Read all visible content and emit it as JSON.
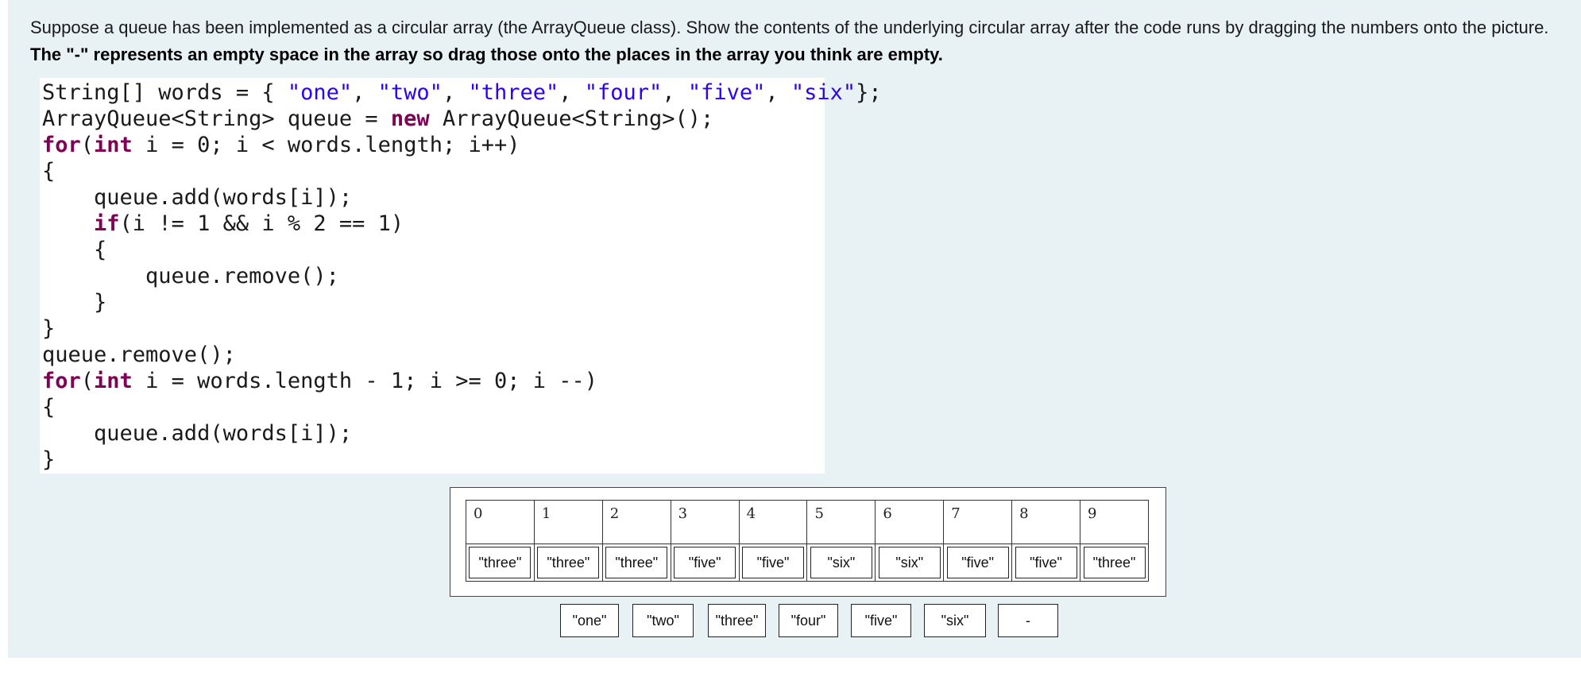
{
  "prompt": {
    "text": "Suppose a queue has been implemented as a circular array (the ArrayQueue class). Show the contents of the underlying circular array after the code runs by dragging the numbers onto the picture. ",
    "bold_text": "The \"-\" represents an empty space in the array so drag those onto the places in the array you think are empty."
  },
  "code": {
    "l1": {
      "a": "String[] words = { ",
      "s1": "\"one\"",
      "c1": ", ",
      "s2": "\"two\"",
      "c2": ", ",
      "s3": "\"three\"",
      "c3": ", ",
      "s4": "\"four\"",
      "c4": ", ",
      "s5": "\"five\"",
      "c5": ", ",
      "s6": "\"six\"",
      "z": "};"
    },
    "l2": {
      "a": "ArrayQueue<String> queue = ",
      "kw": "new",
      "b": " ArrayQueue<String>();"
    },
    "l3": {
      "kw1": "for",
      "a": "(",
      "kw2": "int",
      "b": " i = 0; i < words.length; i++)"
    },
    "l4": "{",
    "l5": "    queue.add(words[i]);",
    "l6": {
      "ind": "    ",
      "kw": "if",
      "b": "(i != 1 && i % 2 == 1)"
    },
    "l7": "    {",
    "l8": "        queue.remove();",
    "l9": "    }",
    "l10": "}",
    "l11": "queue.remove();",
    "l12": {
      "kw1": "for",
      "a": "(",
      "kw2": "int",
      "b": " i = words.length - 1; i >= 0; i --)"
    },
    "l13": "{",
    "l14": "    queue.add(words[i]);",
    "l15": "}"
  },
  "array": {
    "indices": [
      "0",
      "1",
      "2",
      "3",
      "4",
      "5",
      "6",
      "7",
      "8",
      "9"
    ],
    "values": [
      "\"three\"",
      "\"three\"",
      "\"three\"",
      "\"five\"",
      "\"five\"",
      "\"six\"",
      "\"six\"",
      "\"five\"",
      "\"five\"",
      "\"three\""
    ]
  },
  "bank": [
    "\"one\"",
    "\"two\"",
    "\"three\"",
    "\"four\"",
    "\"five\"",
    "\"six\"",
    "-"
  ]
}
